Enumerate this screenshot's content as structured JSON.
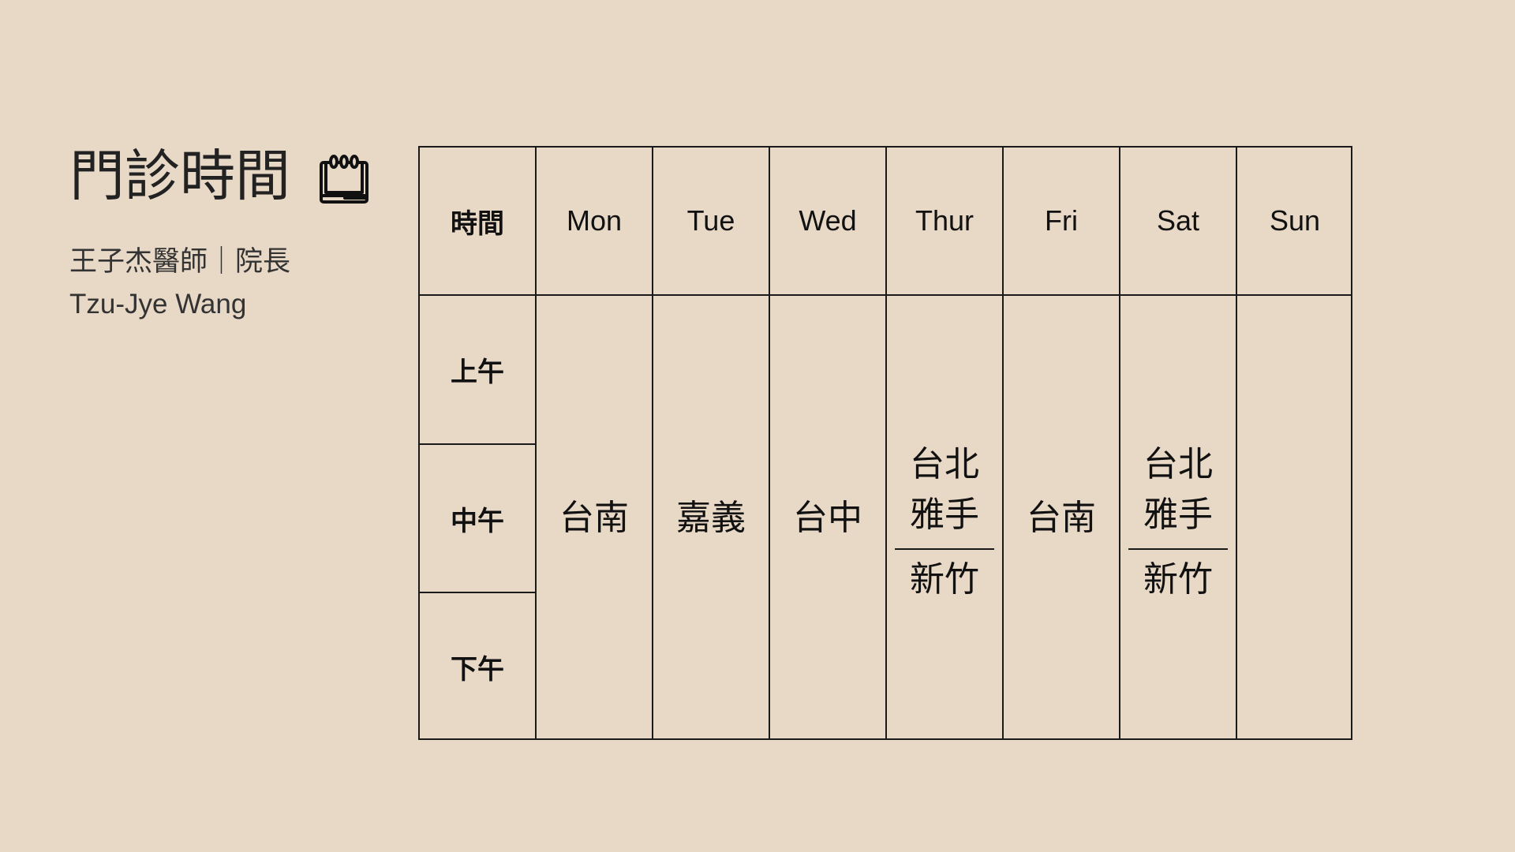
{
  "header": {
    "title": "門診時間",
    "title_icon": "calendar-icon",
    "doctor_line": "王子杰醫師｜院長",
    "doctor_name_en": "Tzu-Jye Wang"
  },
  "schedule": {
    "corner_label": "時間",
    "days": [
      "Mon",
      "Tue",
      "Wed",
      "Thur",
      "Fri",
      "Sat",
      "Sun"
    ],
    "periods": [
      "上午",
      "中午",
      "下午"
    ],
    "entries": {
      "mon": {
        "location": "台南"
      },
      "tue": {
        "location": "嘉義"
      },
      "wed": {
        "location": "台中"
      },
      "thur": {
        "upper_line1": "台北",
        "upper_line2": "雅手",
        "lower": "新竹"
      },
      "fri": {
        "location": "台南"
      },
      "sat": {
        "upper_line1": "台北",
        "upper_line2": "雅手",
        "lower": "新竹"
      },
      "sun": {
        "location": ""
      }
    }
  },
  "colors": {
    "background": "#e8d8c6",
    "border": "#1a1a1a",
    "text": "#111111"
  }
}
